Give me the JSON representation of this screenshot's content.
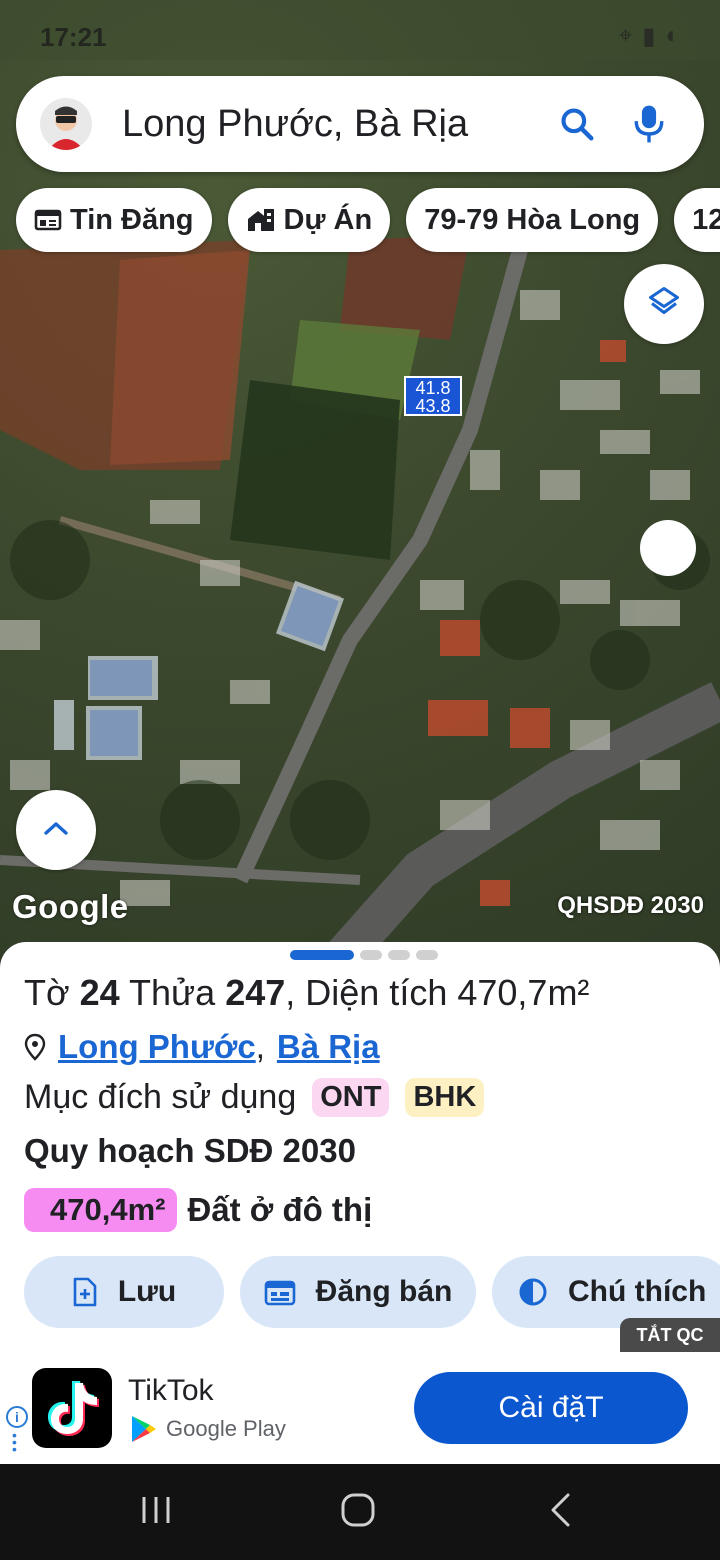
{
  "status_bar": {
    "time": "17:21"
  },
  "search": {
    "query": "Long Phước, Bà Rịa"
  },
  "chips": [
    {
      "label": "Tin Đăng",
      "icon": "newspaper-icon"
    },
    {
      "label": "Dự Án",
      "icon": "building-icon"
    },
    {
      "label": "79-79 Hòa Long",
      "icon": ""
    },
    {
      "label": "12-",
      "icon": ""
    }
  ],
  "map": {
    "parcel_label_top": "41.8",
    "parcel_label_bottom": "43.8",
    "logo": "Google",
    "overlay_label": "QHSDĐ 2030"
  },
  "parcel": {
    "sheet_label": "Tờ",
    "sheet_number": "24",
    "lot_label": "Thửa",
    "lot_number": "247",
    "area_label": ", Diện tích",
    "area_value": "470,7m²",
    "location_parts": [
      "Long Phước",
      "Bà Rịa"
    ],
    "location_separator": ",",
    "purpose_label": "Mục đích sử dụng",
    "purpose_tags": [
      "ONT",
      "BHK"
    ],
    "plan_title": "Quy hoạch SDĐ 2030",
    "plan_area": "470,4m²",
    "plan_desc": "Đất ở đô thị"
  },
  "actions": {
    "save_label": "Lưu",
    "post_label": "Đăng bán",
    "legend_label": "Chú thích"
  },
  "ad": {
    "close_label": "TẮT QC",
    "app_name": "TikTok",
    "store": "Google Play",
    "install_label": "Cài đặT"
  },
  "colors": {
    "accent": "#1a66d2",
    "install_button": "#0b57d0",
    "ont_tag": "#fcd7f2",
    "bhk_tag": "#fdf0c2",
    "area_badge": "#f68cf2",
    "action_button": "#d8e6f8"
  }
}
